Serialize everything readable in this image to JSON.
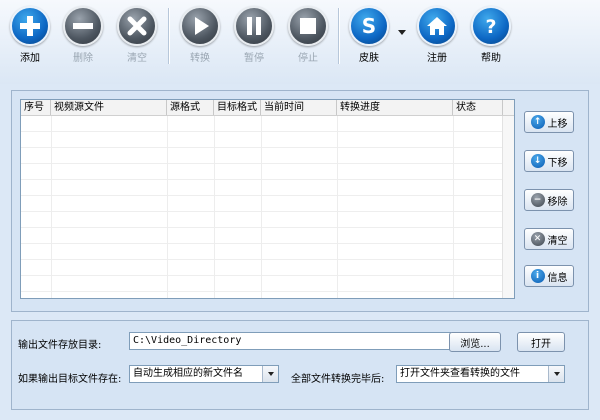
{
  "toolbar": {
    "add": "添加",
    "delete": "删除",
    "clear": "清空",
    "convert": "转换",
    "pause": "暂停",
    "stop": "停止",
    "skin": "皮肤",
    "register": "注册",
    "help": "帮助"
  },
  "file_list": {
    "columns": [
      "序号",
      "视频源文件",
      "源格式",
      "目标格式",
      "当前时间",
      "转换进度",
      "状态"
    ],
    "rows": []
  },
  "side_buttons": {
    "move_up": "上移",
    "move_down": "下移",
    "remove": "移除",
    "clear": "清空",
    "info": "信息"
  },
  "output": {
    "dir_label": "输出文件存放目录:",
    "dir_value": "C:\\Video_Directory",
    "browse": "浏览...",
    "open": "打开",
    "exists_label": "如果输出目标文件存在:",
    "exists_value": "自动生成相应的新文件名",
    "done_label": "全部文件转换完毕后:",
    "done_value": "打开文件夹查看转换的文件"
  },
  "colors": {
    "accent_blue": "#0d67c4",
    "disabled_gray": "#4d5660",
    "window_bg": "#dce8f6"
  }
}
